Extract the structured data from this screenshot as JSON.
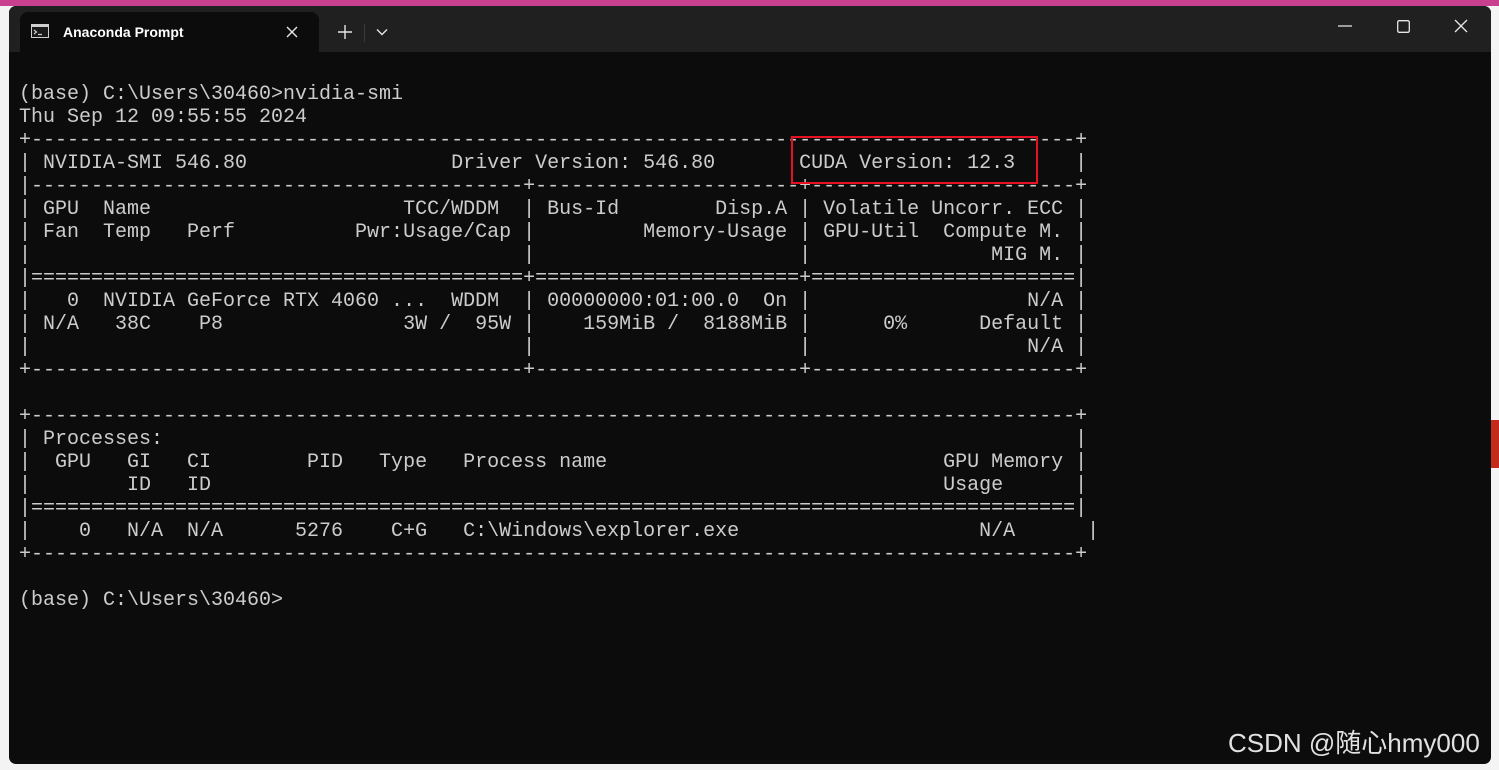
{
  "window": {
    "tab_title": "Anaconda Prompt",
    "tab_icon": "console-icon",
    "tab_close_icon": "close-icon",
    "new_tab_icon": "plus-icon",
    "dropdown_icon": "chevron-down-icon",
    "controls": [
      "minimize-icon",
      "maximize-icon",
      "close-icon"
    ]
  },
  "terminal": {
    "lines": [
      "(base) C:\\Users\\30460>nvidia-smi",
      "Thu Sep 12 09:55:55 2024",
      "+---------------------------------------------------------------------------------------+",
      "| NVIDIA-SMI 546.80                 Driver Version: 546.80       CUDA Version: 12.3     |",
      "|-----------------------------------------+----------------------+----------------------+",
      "| GPU  Name                     TCC/WDDM  | Bus-Id        Disp.A | Volatile Uncorr. ECC |",
      "| Fan  Temp   Perf          Pwr:Usage/Cap |         Memory-Usage | GPU-Util  Compute M. |",
      "|                                         |                      |               MIG M. |",
      "|=========================================+======================+======================|",
      "|   0  NVIDIA GeForce RTX 4060 ...  WDDM  | 00000000:01:00.0  On |                  N/A |",
      "| N/A   38C    P8               3W /  95W |    159MiB /  8188MiB |      0%      Default |",
      "|                                         |                      |                  N/A |",
      "+-----------------------------------------+----------------------+----------------------+",
      "",
      "+---------------------------------------------------------------------------------------+",
      "| Processes:                                                                            |",
      "|  GPU   GI   CI        PID   Type   Process name                            GPU Memory |",
      "|        ID   ID                                                             Usage      |",
      "|=======================================================================================|",
      "|    0   N/A  N/A      5276    C+G   C:\\Windows\\explorer.exe                    N/A      |",
      "+---------------------------------------------------------------------------------------+",
      "",
      "(base) C:\\Users\\30460>"
    ]
  },
  "annotation": {
    "highlight_color": "#e81123"
  },
  "watermark": "CSDN @随心hmy000",
  "colors": {
    "terminal_bg": "#0c0c0c",
    "titlebar_bg": "#202020",
    "text": "#cccccc",
    "accent_strip": "#c9408f"
  }
}
